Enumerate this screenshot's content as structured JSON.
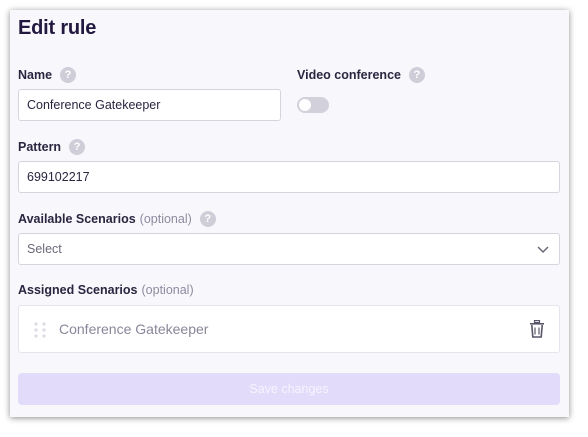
{
  "form": {
    "title": "Edit rule",
    "name": {
      "label": "Name",
      "value": "Conference Gatekeeper"
    },
    "video_conference": {
      "label": "Video conference",
      "enabled": false
    },
    "pattern": {
      "label": "Pattern",
      "value": "699102217"
    },
    "available_scenarios": {
      "label": "Available Scenarios",
      "optional": "(optional)",
      "placeholder": "Select"
    },
    "assigned_scenarios": {
      "label": "Assigned Scenarios",
      "optional": "(optional)",
      "items": [
        "Conference Gatekeeper"
      ]
    },
    "save_label": "Save changes",
    "help_glyph": "?"
  },
  "colors": {
    "title": "#23183f",
    "panel_bg": "#f8f8fc",
    "save_disabled_bg": "#e2dbfa",
    "help_icon": "#cfcdd8"
  },
  "icons": [
    "help-icon",
    "chevron-down-icon",
    "drag-handle-icon",
    "trash-icon"
  ]
}
